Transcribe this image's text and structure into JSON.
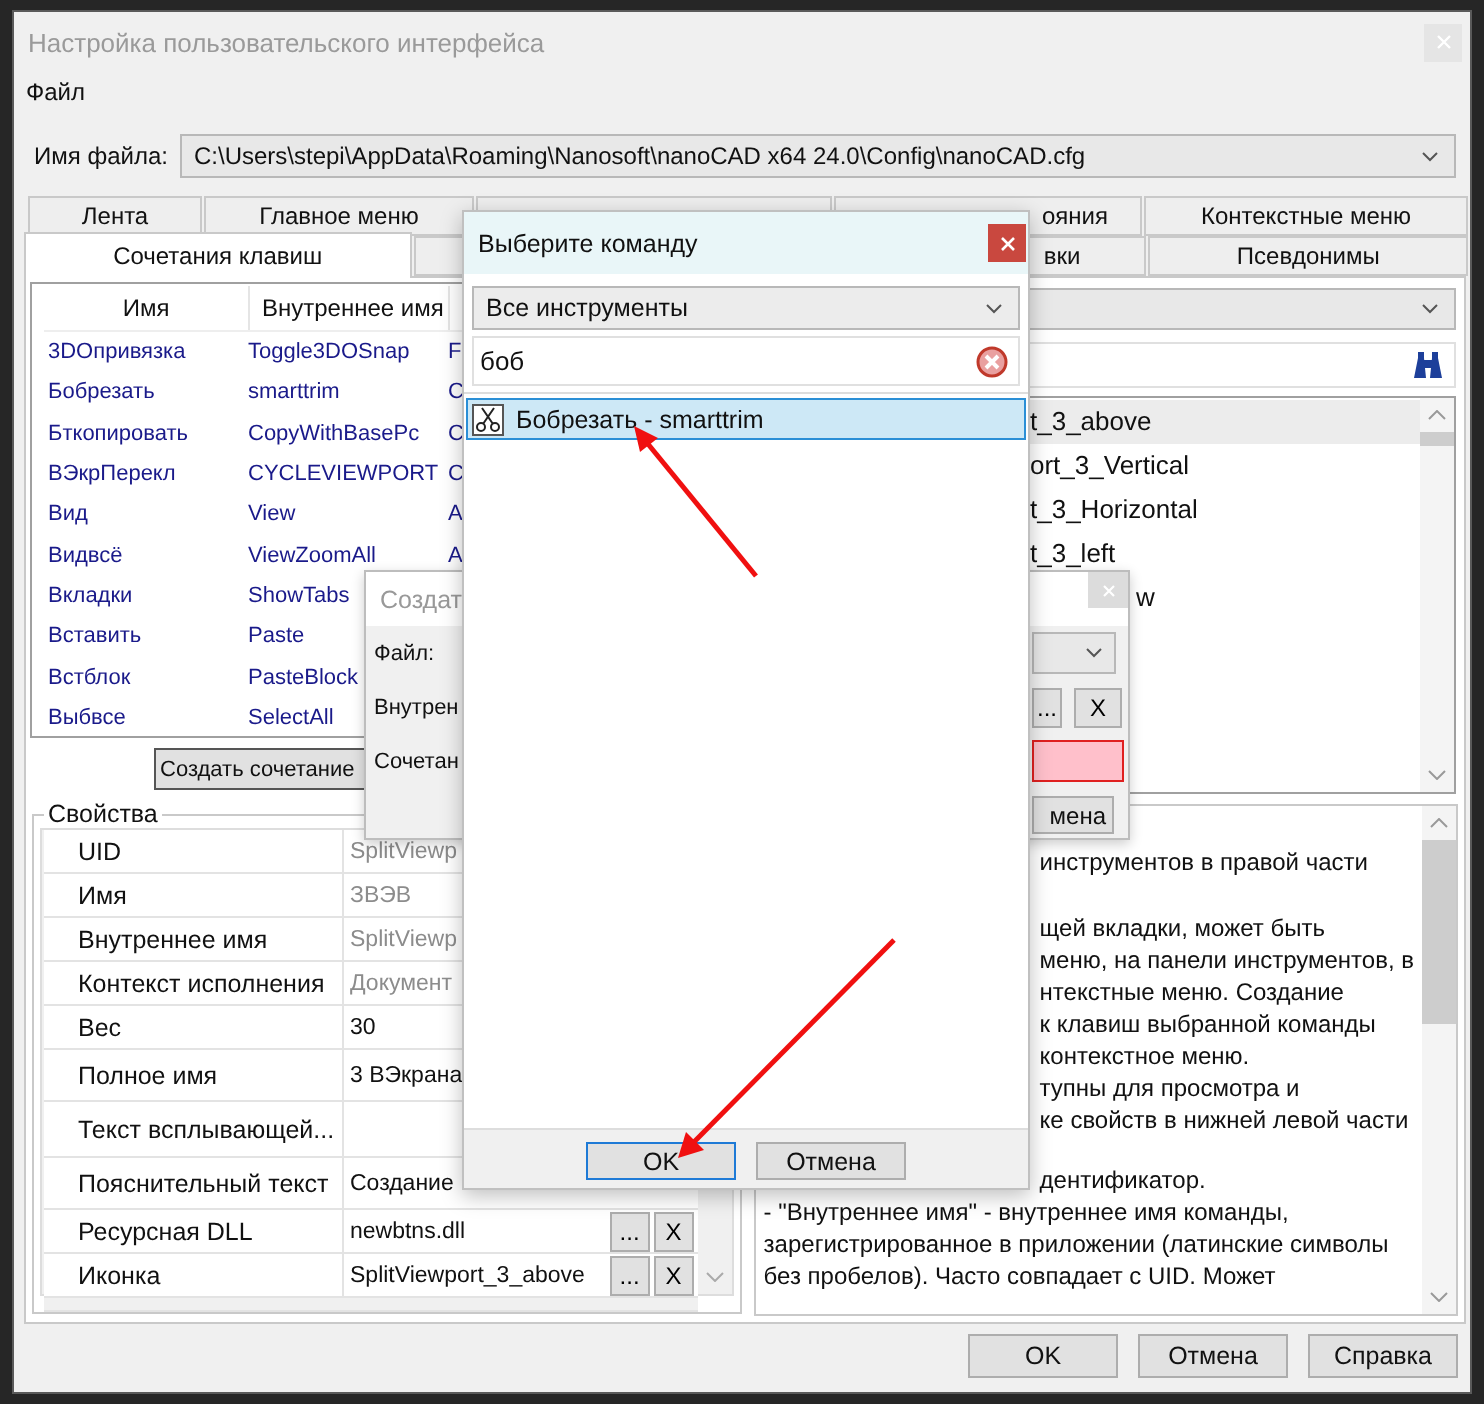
{
  "window": {
    "title": "Настройка пользовательского интерфейса"
  },
  "menu": [
    "Файл"
  ],
  "file": {
    "label": "Имя файла:",
    "value": "C:\\Users\\stepi\\AppData\\Roaming\\Nanosoft\\nanoCAD x64 24.0\\Config\\nanoCAD.cfg"
  },
  "tabs": {
    "row_1": [
      {
        "label": "Лента",
        "selected": false,
        "kind": "full"
      },
      {
        "label": "Главное меню",
        "selected": false,
        "kind": "full"
      },
      {
        "selected": false,
        "kind": "full"
      },
      {
        "label": "ояния",
        "selected": false,
        "kind": "cut"
      },
      {
        "label": "Контекстные меню",
        "selected": false,
        "kind": "full"
      }
    ],
    "row_2": [
      {
        "label": "Сочетания клавиш",
        "selected": true,
        "kind": "full"
      },
      {
        "label": "вки",
        "selected": false,
        "kind": "cut"
      },
      {
        "label": "Псевдонимы",
        "selected": false,
        "kind": "full"
      }
    ]
  },
  "shortcuts": {
    "columns": [
      "Имя",
      "Внутреннее имя"
    ],
    "rows": [
      {
        "name": "3DОпривязка",
        "internal": "Toggle3DOSnap",
        "column_3": "F"
      },
      {
        "name": "Бобрезать",
        "internal": "smarttrim",
        "column_3": "C"
      },
      {
        "name": "Бткопировать",
        "internal": "CopyWithBasePc",
        "column_3": "C"
      },
      {
        "name": "ВЭкрПерекл",
        "internal": "CYCLEVIEWPORT",
        "column_3": "C"
      },
      {
        "name": "Вид",
        "internal": "View",
        "column_3": "A"
      },
      {
        "name": "Видвсё",
        "internal": "ViewZoomAll",
        "column_3": "A"
      },
      {
        "name": "Вкладки",
        "internal": "ShowTabs"
      },
      {
        "name": "Вставить",
        "internal": "Paste"
      },
      {
        "name": "Встблок",
        "internal": "PasteBlock"
      },
      {
        "name": "Выбвсе",
        "internal": "SelectAll"
      }
    ],
    "create_button": "Создать сочетание"
  },
  "commands": {
    "items": [
      {
        "label": "t_3_above",
        "selected": true,
        "kind": "full"
      },
      {
        "label": "ort_3_Vertical",
        "selected": false,
        "kind": "full"
      },
      {
        "label": "t_3_Horizontal",
        "selected": false,
        "kind": "full"
      },
      {
        "label": "t_3_left",
        "selected": false,
        "kind": "full"
      },
      {
        "label": "w",
        "selected": false,
        "kind": "cut"
      }
    ]
  },
  "properties": {
    "title": "Свойства",
    "rows": [
      {
        "name": "UID",
        "value": "SplitViewp",
        "readonly": true
      },
      {
        "name": "Имя",
        "value": "ЗВЭВ",
        "readonly": true
      },
      {
        "name": "Внутреннее имя",
        "value": "SplitViewp",
        "readonly": true
      },
      {
        "name": "Контекст исполнения",
        "value": "Документ",
        "readonly": true
      },
      {
        "name": "Вес",
        "value": "30",
        "readonly": false
      },
      {
        "name": "Полное имя",
        "value": "3 ВЭкрана",
        "readonly": false
      },
      {
        "name": "Текст всплывающей..."
      },
      {
        "name": "Пояснительный текст",
        "value": "Создание",
        "readonly": false
      },
      {
        "name": "Ресурсная DLL",
        "value": "newbtns.dll",
        "readonly": false,
        "actions": [
          "...",
          "X"
        ]
      },
      {
        "name": "Иконка",
        "value": "SplitViewport_3_above",
        "readonly": false,
        "actions": [
          "...",
          "X"
        ]
      }
    ]
  },
  "description": [
    {
      "kind": "cut",
      "text": "инструментов в правой части"
    },
    {
      "kind": "blank"
    },
    {
      "kind": "cut",
      "text": "щей вкладки, может быть"
    },
    {
      "kind": "cut",
      "text": "меню, на панели инструментов, в"
    },
    {
      "kind": "cut",
      "text": "нтекстные меню. Создание"
    },
    {
      "kind": "cut",
      "text": "к клавиш выбранной команды"
    },
    {
      "kind": "cut",
      "text": "контекстное меню."
    },
    {
      "kind": "cut",
      "text": "тупны для просмотра и"
    },
    {
      "kind": "cut",
      "text": "ке свойств в нижней левой части"
    },
    {
      "kind": "blank"
    },
    {
      "kind": "cut",
      "text": "дентификатор."
    },
    {
      "kind": "full",
      "text": " - \"Внутреннее имя\" - внутреннее имя команды,"
    },
    {
      "kind": "full",
      "text": "зарегистрированное в приложении (латинские символы"
    },
    {
      "kind": "full",
      "text": "без пробелов). Часто совпадает с UID. Может"
    }
  ],
  "buttons": [
    "OK",
    "Отмена",
    "Справка"
  ],
  "shortcut_dialog": {
    "title": "Создат",
    "labels": [
      "Файл:",
      "Внутрен",
      "Сочетан"
    ],
    "browse": "...",
    "clear": "X",
    "invalid": true,
    "cancel": "мена"
  },
  "command_dialog": {
    "title": "Выберите команду",
    "category": "Все инструменты",
    "search": "боб",
    "items": [
      {
        "label": "Бобрезать - smarttrim",
        "selected": true
      }
    ],
    "buttons": [
      {
        "label": "OK",
        "default": true
      },
      {
        "label": "Отмена",
        "default": false
      }
    ]
  }
}
